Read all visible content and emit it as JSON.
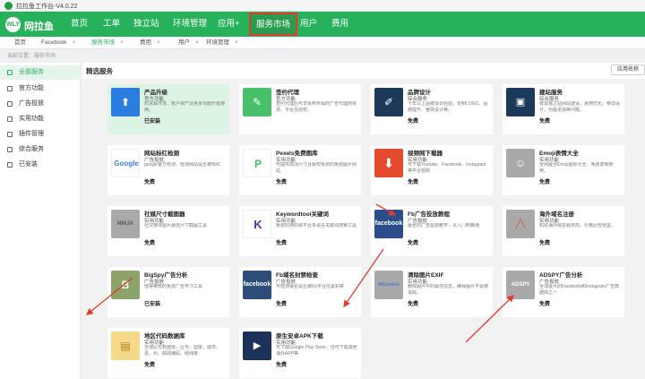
{
  "window": {
    "title": "拉拉鱼工作台-V4.0.22"
  },
  "brand": {
    "name": "网拉鱼",
    "logo_text": "WLY"
  },
  "nav": {
    "items": [
      {
        "label": "首页"
      },
      {
        "label": "工单"
      },
      {
        "label": "独立站"
      },
      {
        "label": "环境管理"
      },
      {
        "label": "应用+"
      },
      {
        "label": "服务市场"
      },
      {
        "label": "用户"
      },
      {
        "label": "费用"
      }
    ]
  },
  "tabs": [
    {
      "label": "首页"
    },
    {
      "label": "Facebook"
    },
    {
      "label": "服务市场"
    },
    {
      "label": "费用"
    },
    {
      "label": "用户"
    },
    {
      "label": "环境管理"
    }
  ],
  "breadcrumb": "当前位置：服务市场",
  "sidebar": {
    "items": [
      {
        "label": "全部服务"
      },
      {
        "label": "官方功能"
      },
      {
        "label": "广告投放"
      },
      {
        "label": "实用功能"
      },
      {
        "label": "插件管理"
      },
      {
        "label": "综合服务"
      },
      {
        "label": "已安装"
      }
    ]
  },
  "main": {
    "title": "精选服务",
    "sort_label": "应用名称"
  },
  "cards": [
    {
      "name": "产品升级",
      "category": "官方功能",
      "desc": "防关联环境、账户资产及更多功能升级使用。",
      "status": "已安装",
      "icon": "cloud-upload-icon",
      "glyph": "⬆"
    },
    {
      "name": "签约代理",
      "category": "官方功能",
      "desc": "签约代理后可享受到专属的广告代理商资源、平台及授权。",
      "status": "",
      "icon": "document-icon",
      "glyph": "✎"
    },
    {
      "name": "品牌设计",
      "category": "综合服务",
      "desc": "十年以上品牌设计经验，定制LOGO、品牌提升、官网设计等。",
      "status": "免费",
      "icon": "design-tools-icon",
      "glyph": "✐"
    },
    {
      "name": "建站服务",
      "category": "综合服务",
      "desc": "按需独立站网站建设，易用优化，移动设计，功能添加等问题。",
      "status": "免费",
      "icon": "website-icon",
      "glyph": "▣"
    },
    {
      "name": "网站标红检测",
      "category": "广告投放",
      "desc": "google官方检测，检测网站是否被标红",
      "status": "免费",
      "icon": "google-logo-icon",
      "glyph": "Google"
    },
    {
      "name": "Pexels免费图库",
      "category": "实用功能",
      "desc": "可提供高清尺寸且版权免费的免费图片网站",
      "status": "免费",
      "icon": "pexels-logo-icon",
      "glyph": "P"
    },
    {
      "name": "视频网下载器",
      "category": "实用功能",
      "desc": "可下载Youtube、Facebook、Instagram等平台视频",
      "status": "免费",
      "icon": "download-icon",
      "glyph": "⬇"
    },
    {
      "name": "Emoji表情大全",
      "category": "实用功能",
      "desc": "全网最全Emoji图标大全，免费复制使用。",
      "status": "免费",
      "icon": "emoji-icon",
      "glyph": "☺"
    },
    {
      "name": "社媒尺寸截图器",
      "category": "实用功能",
      "desc": "社交媒体图片最佳尺寸截图工具",
      "status": "免费",
      "icon": "ninja-icon",
      "glyph": "NINJA"
    },
    {
      "name": "Keywordtool关键词",
      "category": "实用功能",
      "desc": "免费好用的跨平台多语言关键词搜索工具",
      "status": "免费",
      "icon": "keyword-tool-icon",
      "glyph": "K"
    },
    {
      "name": "Fb广告投放教程",
      "category": "广告投放",
      "desc": "最全的广告投放教学，从入门到精通",
      "status": "免费",
      "icon": "facebook-icon",
      "glyph": "facebook"
    },
    {
      "name": "海外域名注册",
      "category": "实用功能",
      "desc": "知名海外域名服务商，价格比较便宜。",
      "status": "免费",
      "icon": "domain-icon",
      "glyph": "╱╲"
    },
    {
      "name": "BigSpy广告分析",
      "category": "广告投放",
      "desc": "值得推荐的免费广告学习工具",
      "status": "已安装",
      "icon": "bigspy-icon",
      "glyph": "B"
    },
    {
      "name": "Fb域名封禁检查",
      "category": "广告投放",
      "desc": "可检测域名是否被Fb平台拉黑封禁",
      "status": "免费",
      "icon": "facebook-icon",
      "glyph": "facebook"
    },
    {
      "name": "清除图片EXIF",
      "category": "实用功能",
      "desc": "删除图片中的属性信息，确保图片不会被追踪。",
      "status": "免费",
      "icon": "exif-icon",
      "glyph": "IMGonline"
    },
    {
      "name": "ADSPY广告分析",
      "category": "广告投放",
      "desc": "全球最大的Facebook和Instagram广告数据库之一",
      "status": "免费",
      "icon": "adspy-icon",
      "glyph": "ADSPY"
    },
    {
      "name": "地区代码数据库",
      "category": "实用功能",
      "desc": "全球区号数据库，区号、国家、城市、县、州、邮政编码、经纬度",
      "status": "免费",
      "icon": "database-icon",
      "glyph": "▤"
    },
    {
      "name": "原生安卓APK下载",
      "category": "实用功能",
      "desc": "可下载Google Play Store、也可下载其他海外APP等",
      "status": "免费",
      "icon": "apk-icon",
      "glyph": "▶"
    }
  ],
  "colors": {
    "brand_green": "#27b15b",
    "annotation_red": "#e23c2a"
  }
}
